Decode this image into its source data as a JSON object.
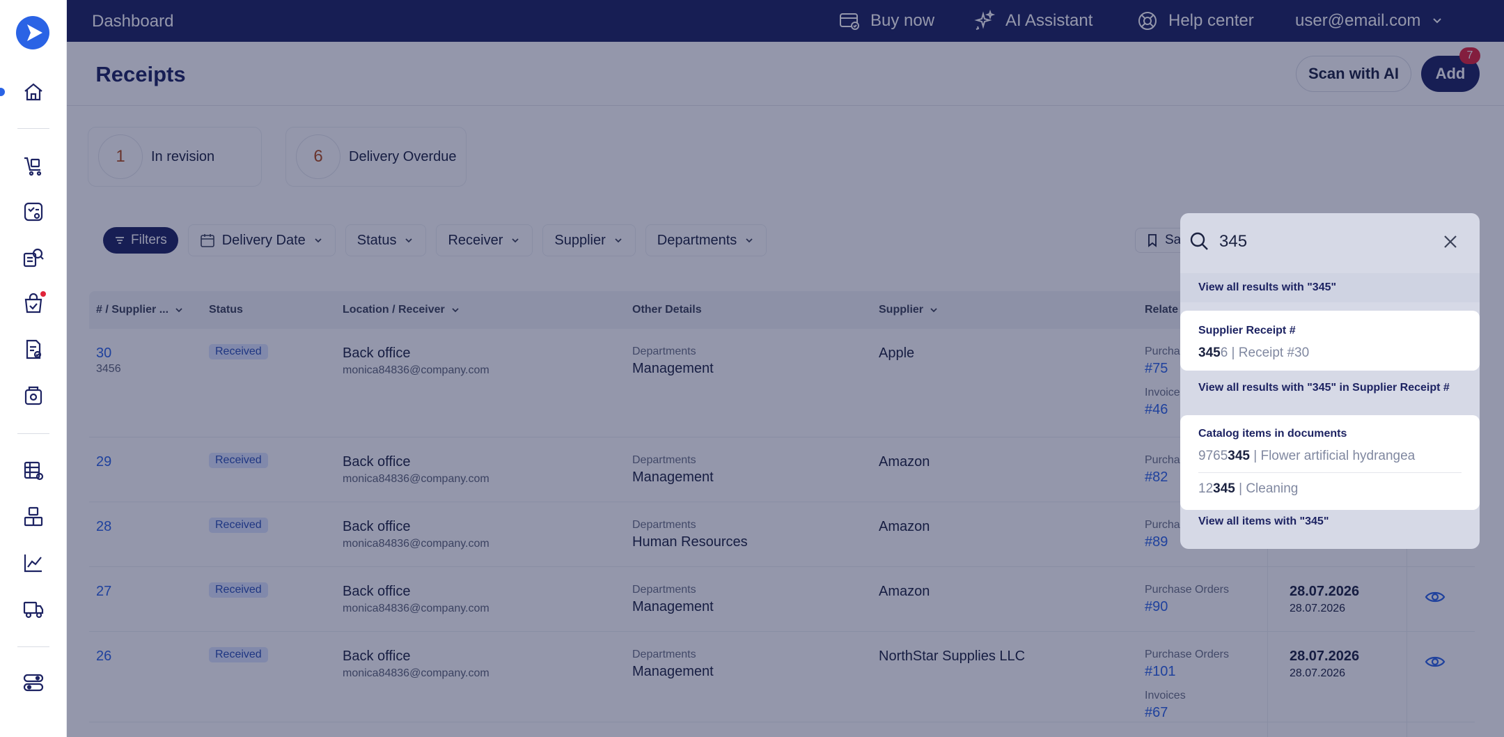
{
  "topbar": {
    "title": "Dashboard",
    "buy_now": "Buy now",
    "ai_assistant": "AI Assistant",
    "help_center": "Help center",
    "user_email": "user@email.com"
  },
  "page": {
    "title": "Receipts",
    "scan_button": "Scan with AI",
    "add_button": "Add",
    "add_badge": "7"
  },
  "status_cards": [
    {
      "count": "1",
      "label": "In revision"
    },
    {
      "count": "6",
      "label": "Delivery Overdue"
    }
  ],
  "filters": {
    "filters_label": "Filters",
    "delivery_date": "Delivery Date",
    "status": "Status",
    "receiver": "Receiver",
    "supplier": "Supplier",
    "departments": "Departments",
    "saved": "Sa"
  },
  "table": {
    "headers": {
      "number": "# / Supplier ...",
      "status": "Status",
      "location": "Location / Receiver",
      "other": "Other Details",
      "supplier": "Supplier",
      "related": "Relate"
    },
    "rows": [
      {
        "num": "30",
        "sub": "3456",
        "status": "Received",
        "location": "Back office",
        "email": "monica84836@company.com",
        "dept_label": "Departments",
        "dept": "Management",
        "supplier": "Apple",
        "rel1_label": "Purcha",
        "rel1": "#75",
        "rel2_label": "Invoice",
        "rel2": "#46",
        "date_b": "",
        "date_s": ""
      },
      {
        "num": "29",
        "sub": "",
        "status": "Received",
        "location": "Back office",
        "email": "monica84836@company.com",
        "dept_label": "Departments",
        "dept": "Management",
        "supplier": "Amazon",
        "rel1_label": "Purcha",
        "rel1": "#82",
        "rel2_label": "",
        "rel2": "",
        "date_b": "",
        "date_s": ""
      },
      {
        "num": "28",
        "sub": "",
        "status": "Received",
        "location": "Back office",
        "email": "monica84836@company.com",
        "dept_label": "Departments",
        "dept": "Human Resources",
        "supplier": "Amazon",
        "rel1_label": "Purcha",
        "rel1": "#89",
        "rel2_label": "",
        "rel2": "",
        "date_b": "",
        "date_s": ""
      },
      {
        "num": "27",
        "sub": "",
        "status": "Received",
        "location": "Back office",
        "email": "monica84836@company.com",
        "dept_label": "Departments",
        "dept": "Management",
        "supplier": "Amazon",
        "rel1_label": "Purchase Orders",
        "rel1": "#90",
        "rel2_label": "",
        "rel2": "",
        "date_b": "28.07.2026",
        "date_s": "28.07.2026"
      },
      {
        "num": "26",
        "sub": "",
        "status": "Received",
        "location": "Back office",
        "email": "monica84836@company.com",
        "dept_label": "Departments",
        "dept": "Management",
        "supplier": "NorthStar Supplies LLC",
        "rel1_label": "Purchase Orders",
        "rel1": "#101",
        "rel2_label": "Invoices",
        "rel2": "#67",
        "date_b": "28.07.2026",
        "date_s": "28.07.2026"
      }
    ]
  },
  "search": {
    "value": "345",
    "view_all": "View all results with \"345\"",
    "group1_title": "Supplier Receipt #",
    "group1_item_match": "345",
    "group1_item_rest": "6",
    "group1_item_detail": " | Receipt #30",
    "view_all_receipts": "View all results with \"345\" in Supplier Receipt #",
    "group2_title": "Catalog items in documents",
    "item1_prefix": "9765",
    "item1_match": "345",
    "item1_detail": " | Flower artificial hydrangea",
    "item2_prefix": "12",
    "item2_match": "345",
    "item2_detail": " | Cleaning",
    "view_all_items": "View all items with \"345\""
  },
  "colors": {
    "brand": "#1d2362",
    "accent": "#2a63e5",
    "alert": "#e0243a"
  }
}
